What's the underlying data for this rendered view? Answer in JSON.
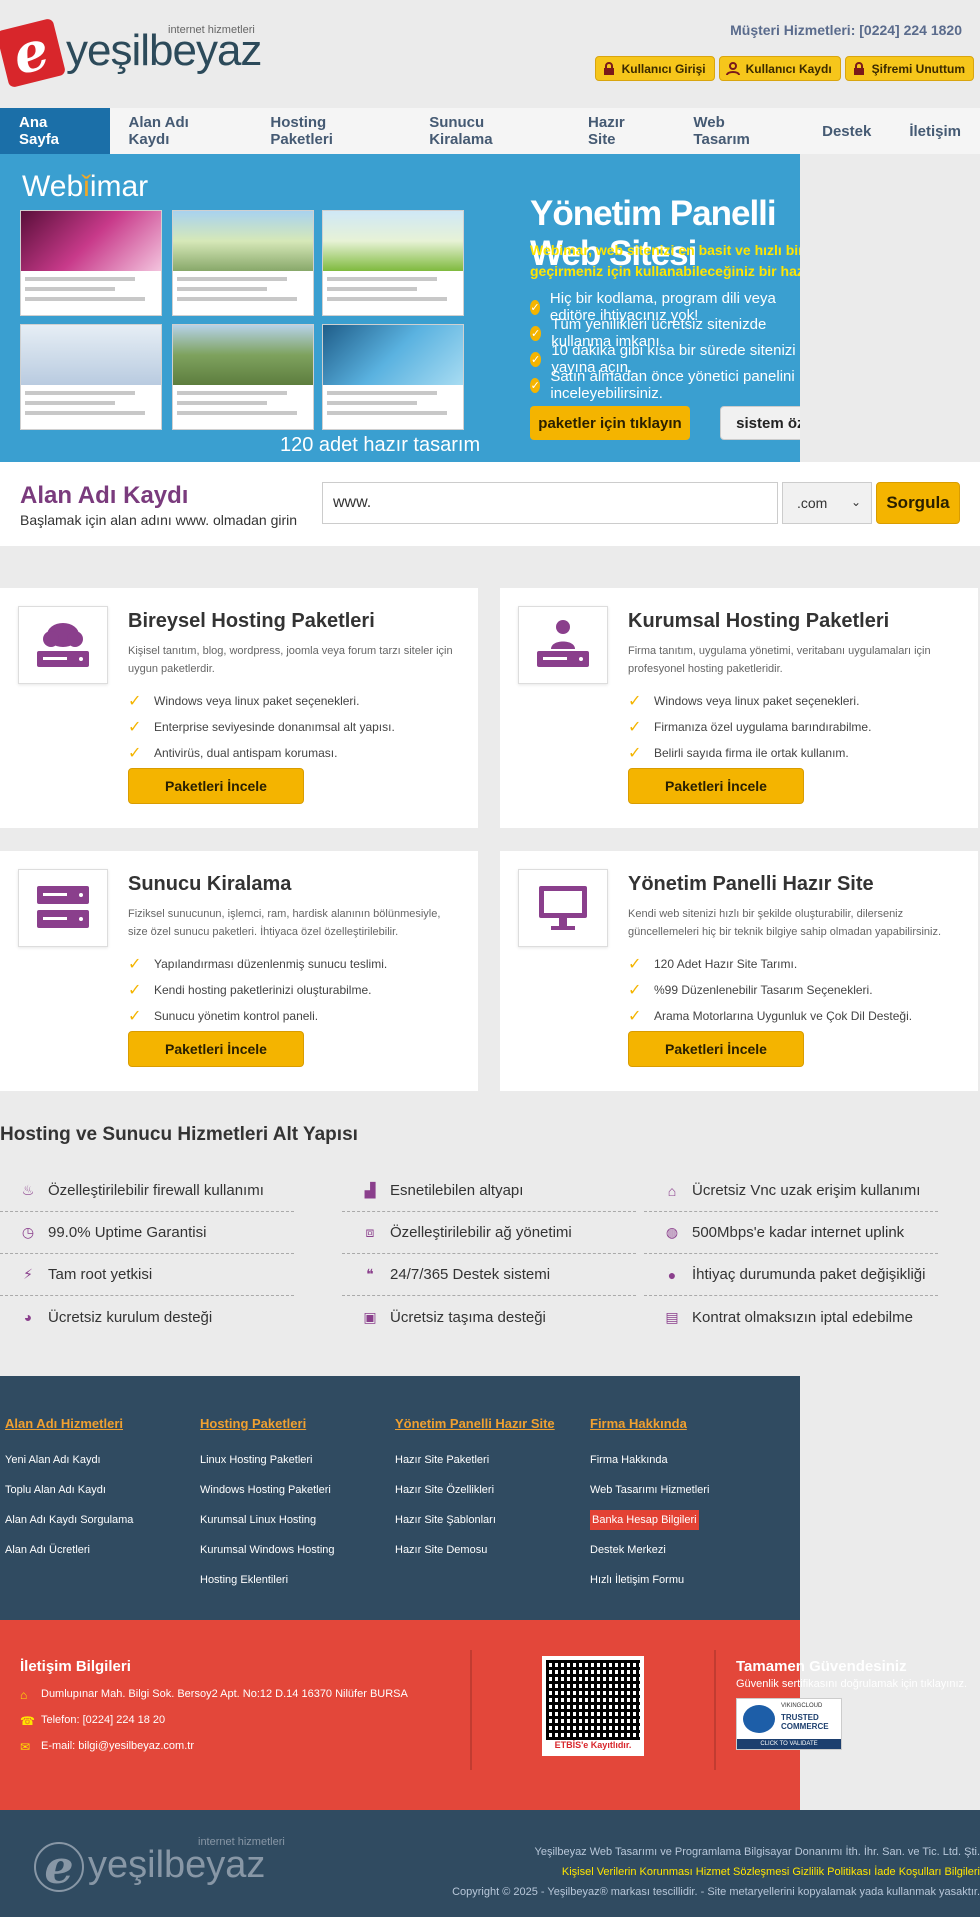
{
  "header": {
    "logo_letter": "e",
    "logo_word": "yeşilbeyaz",
    "logo_sub": "internet hizmetleri",
    "customer_service": "Müşteri Hizmetleri: [0224] 224 1820",
    "buttons": [
      "Kullanıcı Girişi",
      "Kullanıcı Kaydı",
      "Şifremi Unuttum"
    ]
  },
  "nav": {
    "items": [
      "Ana Sayfa",
      "Alan Adı Kaydı",
      "Hosting Paketleri",
      "Sunucu Kiralama",
      "Hazır Site",
      "Web Tasarım",
      "Destek",
      "İletişim"
    ]
  },
  "hero": {
    "brand": "Web",
    "brand2": "imar",
    "caption": "120 adet hazır tasarım",
    "title": "Yönetim Panelli Web Sitesi",
    "subtitle": "Webimar, web sitenizi en basit ve hızlı bir şekilde hayata geçirmeniz için kullanabileceğiniz bir hazır site aracıdır.",
    "features": [
      "Hiç bir kodlama, program dili veya editöre ihtiyacınız yok!",
      "Tüm yenilikleri ücretsiz sitenizde kullanma imkanı.",
      "10 dakika gibi kısa bir sürede sitenizi yayına açın.",
      "Satın almadan önce yönetici panelini inceleyebilirsiniz."
    ],
    "btn_packages": "paketler için tıklayın",
    "btn_features": "sistem özellikleri >>"
  },
  "domain": {
    "title": "Alan Adı Kaydı",
    "subtitle": "Başlamak için alan adını www. olmadan girin",
    "input_value": "www.",
    "tld": ".com",
    "button": "Sorgula"
  },
  "cards": [
    {
      "title": "Bireysel Hosting Paketleri",
      "desc": "Kişisel tanıtım, blog, wordpress, joomla veya forum tarzı siteler için uygun paketlerdir.",
      "items": [
        "Windows veya linux paket seçenekleri.",
        "Enterprise seviyesinde donanımsal alt yapısı.",
        "Antivirüs, dual antispam koruması."
      ],
      "button": "Paketleri İncele"
    },
    {
      "title": "Kurumsal Hosting Paketleri",
      "desc": "Firma tanıtım, uygulama yönetimi, veritabanı uygulamaları için profesyonel hosting paketleridir.",
      "items": [
        "Windows veya linux paket seçenekleri.",
        "Firmanıza özel uygulama barındırabilme.",
        "Belirli sayıda firma ile ortak kullanım."
      ],
      "button": "Paketleri İncele"
    },
    {
      "title": "Sunucu Kiralama",
      "desc": "Fiziksel sunucunun, işlemci, ram, hardisk alanının bölünmesiyle, size özel sunucu paketleri. İhtiyaca özel özelleştirilebilir.",
      "items": [
        "Yapılandırması düzenlenmiş sunucu teslimi.",
        "Kendi hosting paketlerinizi oluşturabilme.",
        "Sunucu yönetim kontrol paneli."
      ],
      "button": "Paketleri İncele"
    },
    {
      "title": "Yönetim Panelli Hazır Site",
      "desc": "Kendi web sitenizi hızlı bir şekilde oluşturabilir, dilerseniz güncellemeleri hiç bir teknik bilgiye sahip olmadan yapabilirsiniz.",
      "items": [
        "120 Adet Hazır Site Tarımı.",
        "%99 Düzenlenebilir Tasarım Seçenekleri.",
        "Arama Motorlarına Uygunluk ve Çok Dil Desteği."
      ],
      "button": "Paketleri İncele"
    }
  ],
  "infra": {
    "title": "Hosting ve Sunucu Hizmetleri Alt Yapısı",
    "columns": [
      [
        "Özelleştirilebilir firewall kullanımı",
        "99.0% Uptime Garantisi",
        "Tam root yetkisi",
        "Ücretsiz kurulum desteği"
      ],
      [
        "Esnetilebilen altyapı",
        "Özelleştirilebilir ağ yönetimi",
        "24/7/365 Destek sistemi",
        "Ücretsiz taşıma desteği"
      ],
      [
        "Ücretsiz Vnc uzak erişim kullanımı",
        "500Mbps'e kadar internet uplink",
        "İhtiyaç durumunda paket değişikliği",
        "Kontrat olmaksızın iptal edebilme"
      ]
    ]
  },
  "footer": {
    "columns": [
      {
        "heading": "Alan Adı Hizmetleri",
        "links": [
          "Yeni Alan Adı Kaydı",
          "Toplu Alan Adı Kaydı",
          "Alan Adı Kaydı Sorgulama",
          "Alan Adı Ücretleri"
        ]
      },
      {
        "heading": "Hosting Paketleri",
        "links": [
          "Linux Hosting Paketleri",
          "Windows Hosting Paketleri",
          "Kurumsal Linux Hosting",
          "Kurumsal Windows Hosting",
          "Hosting Eklentileri"
        ]
      },
      {
        "heading": "Yönetim Panelli Hazır Site",
        "links": [
          "Hazır Site Paketleri",
          "Hazır Site Özellikleri",
          "Hazır Site Şablonları",
          "Hazır Site Demosu"
        ]
      },
      {
        "heading": "Firma Hakkında",
        "links": [
          "Firma Hakkında",
          "Web Tasarımı Hizmetleri",
          "Banka Hesap Bilgileri",
          "Destek Merkezi",
          "Hızlı İletişim Formu"
        ]
      }
    ],
    "contact_title": "İletişim Bilgileri",
    "address": "Dumlupınar Mah. Bilgi Sok. Bersoy2 Apt. No:12 D.14 16370 Nilüfer BURSA",
    "phone": "Telefon: [0224] 224 18 20",
    "email": "E-mail: bilgi@yesilbeyaz.com.tr",
    "etbis": "ETBİS'e Kayıtlıdır.",
    "security_title": "Tamamen Güvendesiniz",
    "security_sub": "Güvenlik sertifikasını doğrulamak için tıklayınız.",
    "seal_brand": "VIKINGCLOUD",
    "seal_line1": "TRUSTED",
    "seal_line2": "COMMERCE",
    "seal_cta": "CLICK TO VALIDATE",
    "company_line": "Yeşilbeyaz Web Tasarımı ve Programlama Bilgisayar Donanımı İth. İhr. San. ve Tic. Ltd. Şti.",
    "links_line": "Kişisel Verilerin Korunması   Hizmet Sözleşmesi   Gizlilik Politikası   İade Koşulları Bilgileri",
    "copyright": "Copyright © 2025 - Yeşilbeyaz® markası tescillidir. - Site metaryellerini kopyalamak yada kullanmak yasaktır."
  },
  "colors": {
    "accent": "#f4b400",
    "nav_active": "#1b6fa8",
    "hero": "#3a9fd0",
    "footer": "#304b61",
    "red_band": "#e3473a",
    "purple": "#7a3b7d"
  }
}
